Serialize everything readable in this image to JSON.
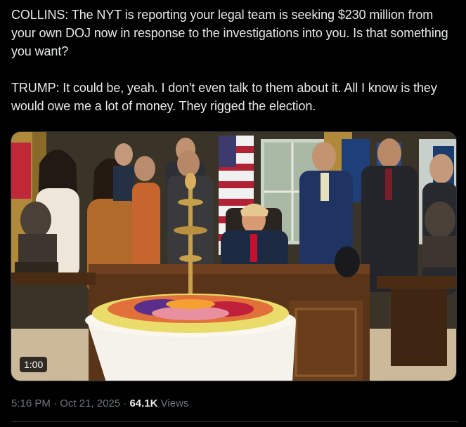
{
  "tweet": {
    "paragraph_1": "COLLINS: The NYT is reporting your legal team is seeking $230 million from your own DOJ now in response to the investigations into you. Is that something you want?",
    "paragraph_2": "TRUMP: It could be, yeah. I don't even talk to them about it. All I know is they would owe me a lot of money. They rigged the election."
  },
  "media": {
    "duration": "1:00"
  },
  "meta": {
    "time": "5:16 PM",
    "separator": "·",
    "date": "Oct 21, 2025",
    "views_count": "64.1K",
    "views_label": "Views"
  },
  "colors": {
    "background": "#000000",
    "text_primary": "#e7e9ea",
    "text_secondary": "#71767b",
    "border": "#2f3336"
  }
}
